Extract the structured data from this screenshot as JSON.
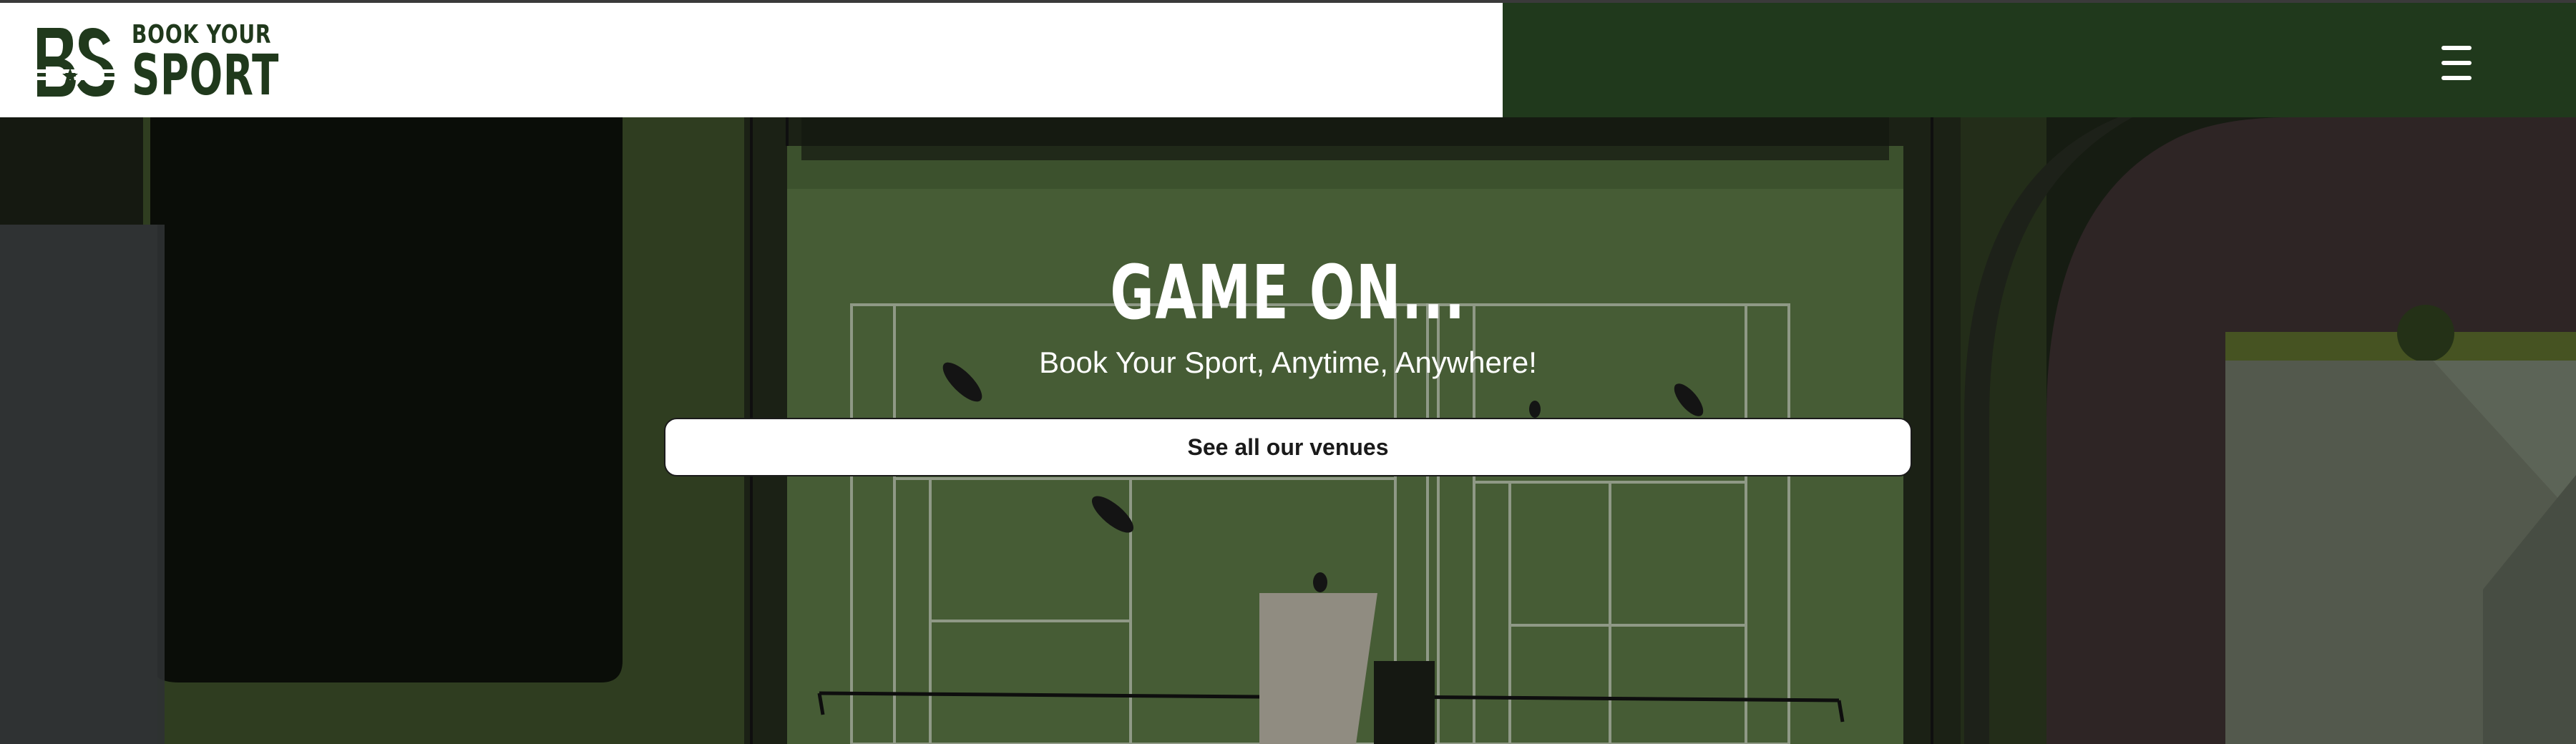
{
  "header": {
    "logo": {
      "mark": "BYS",
      "line1": "BOOK YOUR",
      "line2": "SPORT"
    },
    "menu_icon": "hamburger-menu-icon"
  },
  "hero": {
    "title": "GAME ON...",
    "subtitle": "Book Your Sport, Anytime, Anywhere!",
    "cta_label": "See all our venues",
    "background": "aerial view of tennis courts"
  },
  "colors": {
    "brand_green": "#20391c",
    "header_white": "#ffffff",
    "court_green": "#5d7a45",
    "cta_background": "#ffffff",
    "cta_text": "#1a1a1a"
  }
}
